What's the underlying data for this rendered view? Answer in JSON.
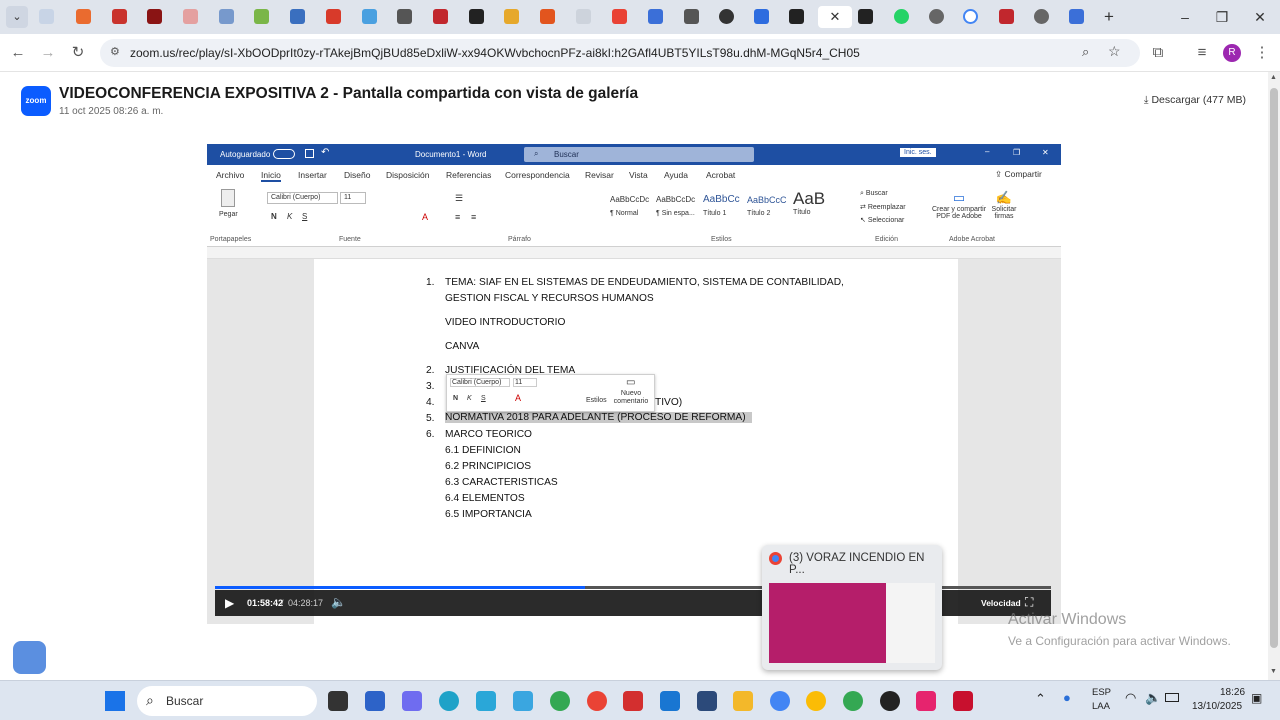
{
  "browser": {
    "url": "zoom.us/rec/play/sI-XbOODprIt0zy-rTAkejBmQjBUd85eDxliW-xx94OKWvbchocnPFz-ai8kI:h2GAfl4UBT5YILsT98u.dhM-MGqN5r4_CH05",
    "profile_initial": "R"
  },
  "recording": {
    "title": "VIDEOCONFERENCIA EXPOSITIVA 2 - Pantalla compartida con vista de galería",
    "date": "11 oct 2025 08:26 a. m.",
    "download": "Descargar (477 MB)",
    "logo_text": "zoom"
  },
  "word": {
    "autosave": "Autoguardado",
    "doc_name": "Documento1 - Word",
    "search": "Buscar",
    "signin": "Inic. ses.",
    "tabs": [
      "Archivo",
      "Inicio",
      "Insertar",
      "Diseño",
      "Disposición",
      "Referencias",
      "Correspondencia",
      "Revisar",
      "Vista",
      "Ayuda",
      "Acrobat"
    ],
    "share": "Compartir",
    "font_name": "Calibri (Cuerpo)",
    "font_size": "11",
    "paste": "Pegar",
    "styles": [
      {
        "preview": "AaBbCcDc",
        "name": "¶ Normal"
      },
      {
        "preview": "AaBbCcDc",
        "name": "¶ Sin espa..."
      },
      {
        "preview": "AaBbCc",
        "name": "Título 1"
      },
      {
        "preview": "AaBbCcC",
        "name": "Título 2"
      },
      {
        "preview": "AaB",
        "name": "Título"
      }
    ],
    "editing": {
      "find": "Buscar",
      "replace": "Reemplazar",
      "select": "Seleccionar"
    },
    "acrobat": {
      "create": "Crear y compartir PDF de Adobe",
      "sign": "Solicitar firmas"
    },
    "groups": [
      "Portapapeles",
      "Fuente",
      "Párrafo",
      "Estilos",
      "Edición",
      "Adobe Acrobat"
    ],
    "doc": {
      "l1_num": "1.",
      "l1a": "TEMA: SIAF EN EL SISTEMAS DE ENDEUDAMIENTO, SISTEMA DE CONTABILIDAD,",
      "l1b": "GESTION FISCAL Y RECURSOS HUMANOS",
      "video": "VIDEO INTRODUCTORIO",
      "canva": "CANVA",
      "l2_num": "2.",
      "l2": "JUSTIFICACIÓN DEL TEMA",
      "l3_num": "3.",
      "l4_num": "4.",
      "l4_tail": "TIVO)",
      "l5_num": "5.",
      "l5": "NORMATIVA 2018 PARA ADELANTE (PROCESO DE REFORMA)",
      "l6_num": "6.",
      "l6": "MARCO TEORICO",
      "subs": [
        "6.1 DEFINICION",
        "6.2 PRINCIPICIOS",
        "6.3 CARACTERISTICAS",
        "6.4 ELEMENTOS",
        "6.5 IMPORTANCIA"
      ]
    },
    "minitoolbar": {
      "font": "Calibri (Cuerpo)",
      "size": "11",
      "styles": "Estilos",
      "comment": "Nuevo comentario"
    }
  },
  "player": {
    "current": "01:58:42",
    "separator": "/",
    "total": "04:28:17",
    "speed": "Velocidad",
    "progress_fraction": 0.442
  },
  "preview": {
    "title": "(3) VORAZ INCENDIO EN P..."
  },
  "watermark": {
    "line1": "Activar Windows",
    "line2": "Ve a Configuración para activar Windows."
  },
  "taskbar": {
    "search": "Buscar",
    "lang1": "ESP",
    "lang2": "LAA",
    "time": "18:26",
    "date": "13/10/2025"
  },
  "colors": {
    "word_blue": "#1e4fa3",
    "zoom_blue": "#0b5cff"
  }
}
